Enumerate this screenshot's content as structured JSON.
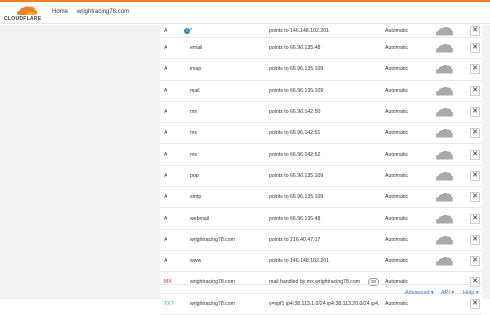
{
  "brand": {
    "name": "CLOUDFLARE",
    "accent": "#f38020"
  },
  "nav": {
    "home": "Home",
    "domain": "wrightracing78.com"
  },
  "records": [
    {
      "type": "A",
      "type_class": "",
      "name": "*",
      "has_info": true,
      "info_label": "i",
      "value": "points to 146.148.102.201",
      "priority": "",
      "ttl": "Automatic",
      "proxy": "cloud-icon",
      "delete_label": "✕"
    },
    {
      "type": "A",
      "type_class": "",
      "name": "email",
      "has_info": false,
      "info_label": "",
      "value": "points to 66.96.135.48",
      "priority": "",
      "ttl": "Automatic",
      "proxy": "cloud-icon",
      "delete_label": "✕"
    },
    {
      "type": "A",
      "type_class": "",
      "name": "imap",
      "has_info": false,
      "info_label": "",
      "value": "points to 66.96.135.109",
      "priority": "",
      "ttl": "Automatic",
      "proxy": "cloud-icon",
      "delete_label": "✕"
    },
    {
      "type": "A",
      "type_class": "",
      "name": "mail",
      "has_info": false,
      "info_label": "",
      "value": "points to 66.96.135.109",
      "priority": "",
      "ttl": "Automatic",
      "proxy": "cloud-icon",
      "delete_label": "✕"
    },
    {
      "type": "A",
      "type_class": "",
      "name": "mx",
      "has_info": false,
      "info_label": "",
      "value": "points to 66.96.142.50",
      "priority": "",
      "ttl": "Automatic",
      "proxy": "cloud-icon",
      "delete_label": "✕"
    },
    {
      "type": "A",
      "type_class": "",
      "name": "mx",
      "has_info": false,
      "info_label": "",
      "value": "points to 66.96.142.51",
      "priority": "",
      "ttl": "Automatic",
      "proxy": "cloud-icon",
      "delete_label": "✕"
    },
    {
      "type": "A",
      "type_class": "",
      "name": "mx",
      "has_info": false,
      "info_label": "",
      "value": "points to 66.96.142.52",
      "priority": "",
      "ttl": "Automatic",
      "proxy": "cloud-icon",
      "delete_label": "✕"
    },
    {
      "type": "A",
      "type_class": "",
      "name": "pop",
      "has_info": false,
      "info_label": "",
      "value": "points to 66.96.135.109",
      "priority": "",
      "ttl": "Automatic",
      "proxy": "cloud-icon",
      "delete_label": "✕"
    },
    {
      "type": "A",
      "type_class": "",
      "name": "smtp",
      "has_info": false,
      "info_label": "",
      "value": "points to 66.96.135.109",
      "priority": "",
      "ttl": "Automatic",
      "proxy": "cloud-icon",
      "delete_label": "✕"
    },
    {
      "type": "A",
      "type_class": "",
      "name": "webmail",
      "has_info": false,
      "info_label": "",
      "value": "points to 66.96.135.48",
      "priority": "",
      "ttl": "Automatic",
      "proxy": "cloud-icon",
      "delete_label": "✕"
    },
    {
      "type": "A",
      "type_class": "",
      "name": "wrightracing78.com",
      "has_info": false,
      "info_label": "",
      "value": "points to 216.40.47.17",
      "priority": "",
      "ttl": "Automatic",
      "proxy": "cloud-icon",
      "delete_label": "✕"
    },
    {
      "type": "A",
      "type_class": "",
      "name": "www",
      "has_info": false,
      "info_label": "",
      "value": "points to 146.148.102.201",
      "priority": "",
      "ttl": "Automatic",
      "proxy": "cloud-icon",
      "delete_label": "✕"
    },
    {
      "type": "MX",
      "type_class": "mx",
      "name": "wrightracing78.com",
      "has_info": false,
      "info_label": "",
      "value": "mail handled by mx.wrightracing78.com",
      "priority": "30",
      "ttl": "Automatic",
      "proxy": "",
      "delete_label": "✕"
    },
    {
      "type": "TXT",
      "type_class": "txt",
      "name": "wrightracing78.com",
      "has_info": false,
      "info_label": "",
      "value": "v=spf1 ip4:38.113.1.0/24 ip4:38.113.20.0/24 ip4...",
      "priority": "",
      "ttl": "Automatic",
      "proxy": "",
      "delete_label": "✕"
    }
  ],
  "footer": {
    "advanced": "Advanced ▾",
    "api": "API ▾",
    "help": "Help ▾"
  },
  "colors": {
    "cloud_grey": "#a9a9a9",
    "link": "#2b7bd0",
    "mx": "#e0257f",
    "txt": "#2ea8c8"
  }
}
